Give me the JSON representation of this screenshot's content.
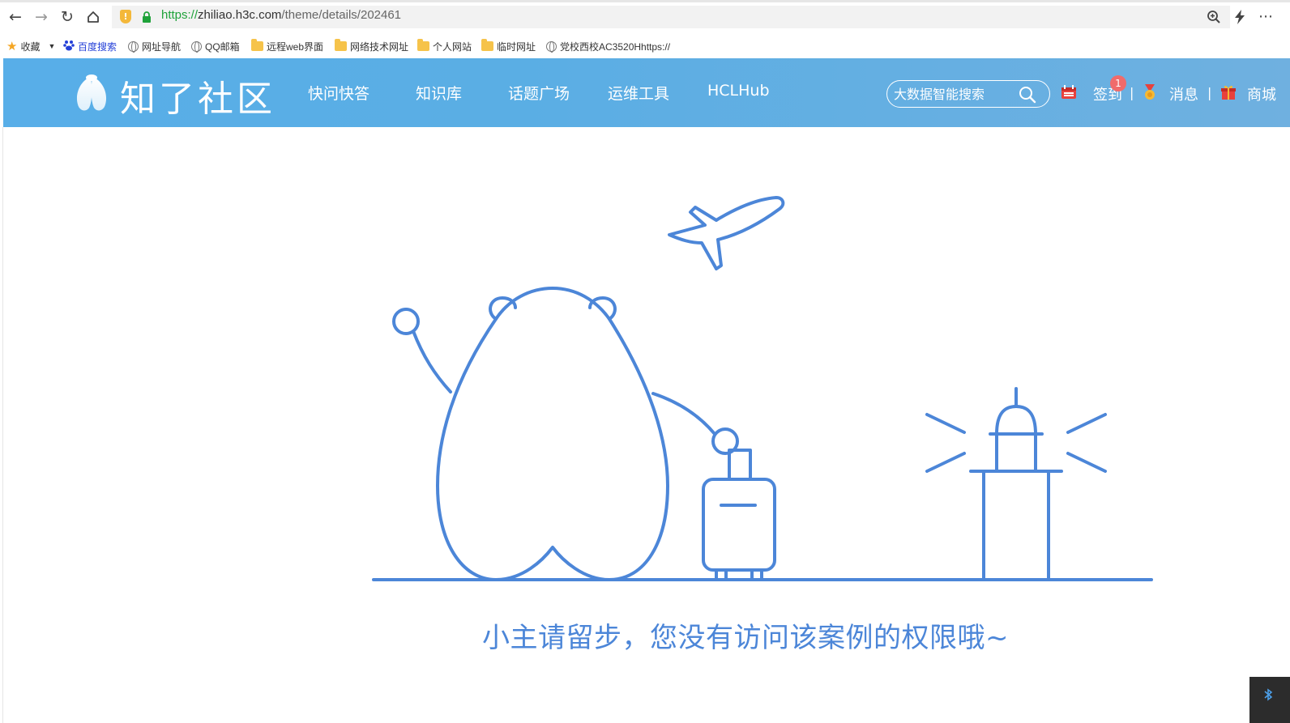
{
  "browser": {
    "url_scheme": "https://",
    "url_host": "zhiliao.h3c.com",
    "url_path": "/theme/details/202461",
    "icons": [
      "back-icon",
      "forward-icon",
      "reload-icon",
      "home-icon",
      "zoom-icon",
      "lightning-icon",
      "more-icon"
    ]
  },
  "bookmarks": {
    "favorites_label": "收藏",
    "items": [
      {
        "label": "百度搜索",
        "icon": "baidu-icon"
      },
      {
        "label": "网址导航",
        "icon": "globe-icon"
      },
      {
        "label": "QQ邮箱",
        "icon": "globe-icon"
      },
      {
        "label": "远程web界面",
        "icon": "folder-icon"
      },
      {
        "label": "网络技术网址",
        "icon": "folder-icon"
      },
      {
        "label": "个人网站",
        "icon": "folder-icon"
      },
      {
        "label": "临时网址",
        "icon": "folder-icon"
      },
      {
        "label": "党校西校AC3520Hhttps://",
        "icon": "globe-icon"
      }
    ]
  },
  "header": {
    "logo_text": "知了社区",
    "nav": [
      "快问快答",
      "知识库",
      "话题广场",
      "运维工具",
      "HCLHub"
    ],
    "search_placeholder": "大数据智能搜索",
    "signin_label": "签到",
    "signin_badge": "1",
    "sep": "|",
    "messages_label": "消息",
    "shop_label": "商城"
  },
  "main": {
    "message": "小主请留步，您没有访问该案例的权限哦~"
  },
  "colors": {
    "header_blue": "#5aaee4",
    "illustration_blue": "#4c86d8",
    "badge_red": "#f06b6b"
  }
}
